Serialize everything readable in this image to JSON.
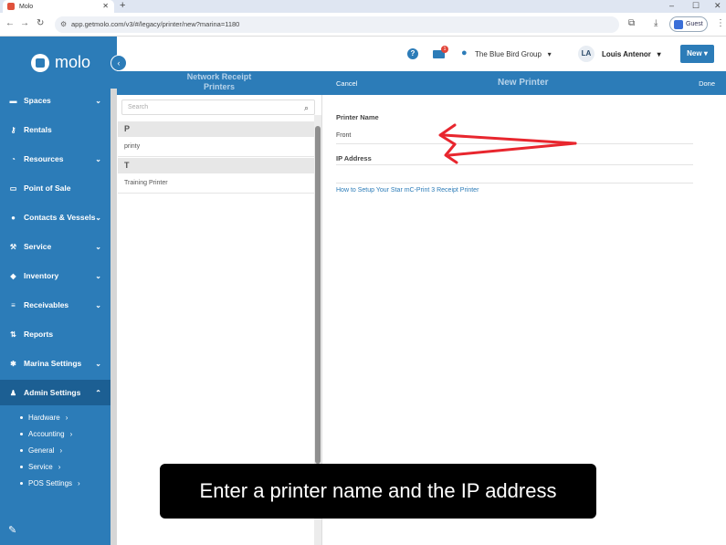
{
  "browser": {
    "tab_title": "Molo",
    "url": "app.getmolo.com/v3/#/legacy/printer/new?marina=1180",
    "guest_label": "Guest"
  },
  "sidebar": {
    "brand": "molo",
    "items": [
      {
        "label": "Spaces",
        "icon": "bed-icon",
        "has_chevron": true
      },
      {
        "label": "Rentals",
        "icon": "key-icon",
        "has_chevron": false
      },
      {
        "label": "Resources",
        "icon": "dashboard-icon",
        "has_chevron": true
      },
      {
        "label": "Point of Sale",
        "icon": "card-icon",
        "has_chevron": false
      },
      {
        "label": "Contacts & Vessels",
        "icon": "person-icon",
        "has_chevron": true
      },
      {
        "label": "Service",
        "icon": "wrench-icon",
        "has_chevron": true
      },
      {
        "label": "Inventory",
        "icon": "tag-icon",
        "has_chevron": true
      },
      {
        "label": "Receivables",
        "icon": "list-icon",
        "has_chevron": true
      },
      {
        "label": "Reports",
        "icon": "sort-icon",
        "has_chevron": false
      },
      {
        "label": "Marina Settings",
        "icon": "gear-icon",
        "has_chevron": true
      },
      {
        "label": "Admin Settings",
        "icon": "users-icon",
        "has_chevron": true,
        "active": true
      }
    ],
    "subitems": [
      "Hardware",
      "Accounting",
      "General",
      "Service",
      "POS Settings"
    ]
  },
  "header": {
    "notification_count": "1",
    "group": "The Blue Bird Group",
    "user_initials": "LA",
    "user_name": "Louis Antenor",
    "new_button": "New"
  },
  "subheader": {
    "left_title": "Network Receipt Printers",
    "cancel": "Cancel",
    "right_title": "New Printer",
    "done": "Done"
  },
  "list": {
    "search_placeholder": "Search",
    "groups": [
      {
        "letter": "P",
        "items": [
          "printy"
        ]
      },
      {
        "letter": "T",
        "items": [
          "Training Printer"
        ]
      }
    ]
  },
  "form": {
    "printer_name_label": "Printer Name",
    "printer_name_value": "Front",
    "ip_address_label": "IP Address",
    "ip_address_value": "",
    "help_link": "How to Setup Your Star mC-Print 3 Receipt Printer"
  },
  "annotation": {
    "arrow_color": "#e8262e"
  },
  "caption": "Enter a printer name and the IP address"
}
